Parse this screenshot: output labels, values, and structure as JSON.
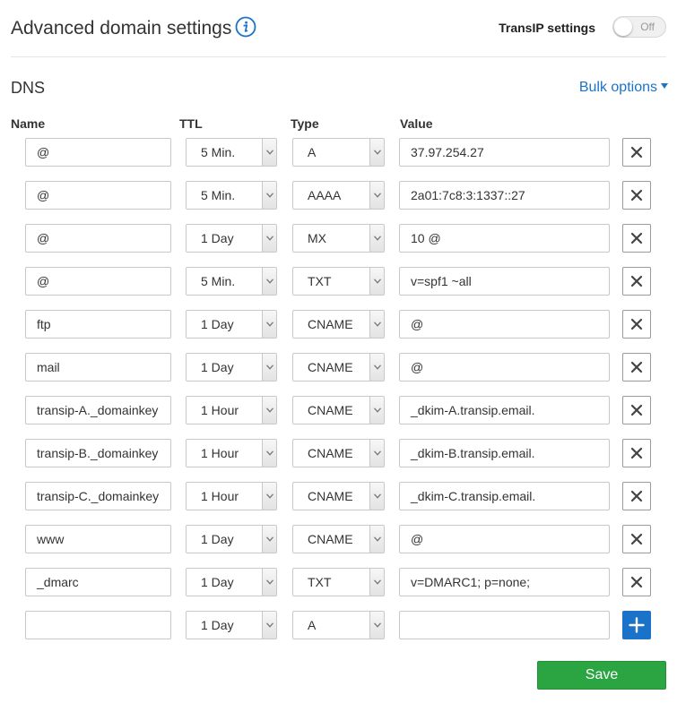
{
  "header": {
    "title": "Advanced domain settings",
    "info_icon": "info-icon",
    "transip_label": "TransIP settings",
    "toggle_state": "Off"
  },
  "dns": {
    "title": "DNS",
    "bulk_options_label": "Bulk options",
    "columns": {
      "name": "Name",
      "ttl": "TTL",
      "type": "Type",
      "value": "Value"
    },
    "records": [
      {
        "name": "@",
        "ttl": "5 Min.",
        "type": "A",
        "value": "37.97.254.27"
      },
      {
        "name": "@",
        "ttl": "5 Min.",
        "type": "AAAA",
        "value": "2a01:7c8:3:1337::27"
      },
      {
        "name": "@",
        "ttl": "1 Day",
        "type": "MX",
        "value": "10 @"
      },
      {
        "name": "@",
        "ttl": "5 Min.",
        "type": "TXT",
        "value": "v=spf1 ~all"
      },
      {
        "name": "ftp",
        "ttl": "1 Day",
        "type": "CNAME",
        "value": "@"
      },
      {
        "name": "mail",
        "ttl": "1 Day",
        "type": "CNAME",
        "value": "@"
      },
      {
        "name": "transip-A._domainkey",
        "ttl": "1 Hour",
        "type": "CNAME",
        "value": "_dkim-A.transip.email."
      },
      {
        "name": "transip-B._domainkey",
        "ttl": "1 Hour",
        "type": "CNAME",
        "value": "_dkim-B.transip.email."
      },
      {
        "name": "transip-C._domainkey",
        "ttl": "1 Hour",
        "type": "CNAME",
        "value": "_dkim-C.transip.email."
      },
      {
        "name": "www",
        "ttl": "1 Day",
        "type": "CNAME",
        "value": "@"
      },
      {
        "name": "_dmarc",
        "ttl": "1 Day",
        "type": "TXT",
        "value": "v=DMARC1; p=none;"
      }
    ],
    "new_record": {
      "name": "",
      "ttl": "1 Day",
      "type": "A",
      "value": ""
    }
  },
  "save_label": "Save",
  "colors": {
    "accent": "#1a73c8",
    "save": "#2aa542"
  }
}
